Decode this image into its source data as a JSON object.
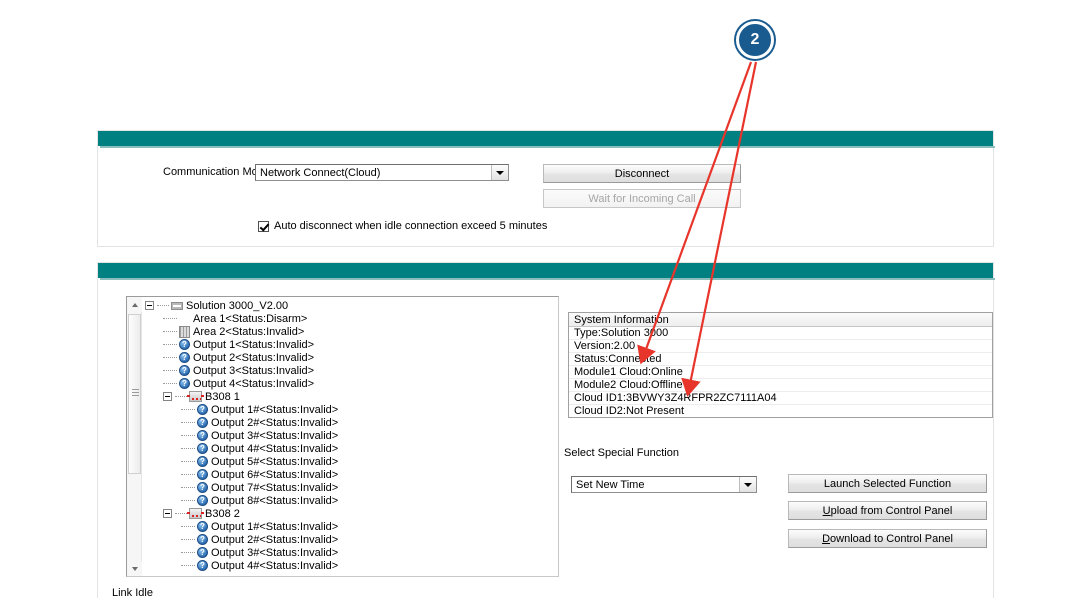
{
  "callout": {
    "number": "2",
    "color": "#1a5b8f"
  },
  "theme": {
    "accent_teal": "#008080",
    "annotation_red": "#e8352b"
  },
  "connection_panel": {
    "communication_model_label": "Communication Model",
    "communication_model_value": "Network Connect(Cloud)",
    "disconnect_button": "Disconnect",
    "wait_for_incoming_call_button": "Wait for Incoming Call",
    "auto_disconnect_checkbox": "Auto disconnect when idle connection exceed 5 minutes"
  },
  "tree": {
    "items": [
      {
        "label": "Solution 3000_V2.00",
        "level": 0,
        "icon": "root-panel-icon",
        "expander": "minus"
      },
      {
        "label": "Area  1<Status:Disarm>",
        "level": 1,
        "icon": "green-bulb-icon"
      },
      {
        "label": "Area  2<Status:Invalid>",
        "level": 1,
        "icon": "area-grey-icon"
      },
      {
        "label": "Output 1<Status:Invalid>",
        "level": 1,
        "icon": "output-blue-icon"
      },
      {
        "label": "Output 2<Status:Invalid>",
        "level": 1,
        "icon": "output-blue-icon"
      },
      {
        "label": "Output 3<Status:Invalid>",
        "level": 1,
        "icon": "output-blue-icon"
      },
      {
        "label": "Output 4<Status:Invalid>",
        "level": 1,
        "icon": "output-blue-icon"
      },
      {
        "label": "B308  1",
        "level": 1,
        "icon": "b308-module-icon",
        "expander": "minus"
      },
      {
        "label": "Output 1#<Status:Invalid>",
        "level": 2,
        "icon": "output-blue-icon"
      },
      {
        "label": "Output 2#<Status:Invalid>",
        "level": 2,
        "icon": "output-blue-icon"
      },
      {
        "label": "Output 3#<Status:Invalid>",
        "level": 2,
        "icon": "output-blue-icon"
      },
      {
        "label": "Output 4#<Status:Invalid>",
        "level": 2,
        "icon": "output-blue-icon"
      },
      {
        "label": "Output 5#<Status:Invalid>",
        "level": 2,
        "icon": "output-blue-icon"
      },
      {
        "label": "Output 6#<Status:Invalid>",
        "level": 2,
        "icon": "output-blue-icon"
      },
      {
        "label": "Output 7#<Status:Invalid>",
        "level": 2,
        "icon": "output-blue-icon"
      },
      {
        "label": "Output 8#<Status:Invalid>",
        "level": 2,
        "icon": "output-blue-icon"
      },
      {
        "label": "B308  2",
        "level": 1,
        "icon": "b308-module-icon",
        "expander": "minus"
      },
      {
        "label": "Output 1#<Status:Invalid>",
        "level": 2,
        "icon": "output-blue-icon"
      },
      {
        "label": "Output 2#<Status:Invalid>",
        "level": 2,
        "icon": "output-blue-icon"
      },
      {
        "label": "Output 3#<Status:Invalid>",
        "level": 2,
        "icon": "output-blue-icon"
      },
      {
        "label": "Output 4#<Status:Invalid>",
        "level": 2,
        "icon": "output-blue-icon"
      }
    ]
  },
  "system_information": {
    "header": "System Information",
    "rows": [
      "Type:Solution 3000",
      "Version:2.00",
      "Status:Connected",
      "Module1 Cloud:Online",
      "Module2 Cloud:Offline",
      "Cloud ID1:3BVWY3Z4RFPR2ZC7111A04",
      "Cloud ID2:Not Present"
    ]
  },
  "special_function": {
    "label": "Select Special Function",
    "selected": "Set New Time",
    "launch_button": "Launch Selected Function",
    "upload_button_accel": "U",
    "upload_button_rest": "pload from Control Panel",
    "download_button_accel": "D",
    "download_button_rest": "ownload to Control Panel"
  },
  "status_bar": {
    "text": "Link Idle"
  }
}
